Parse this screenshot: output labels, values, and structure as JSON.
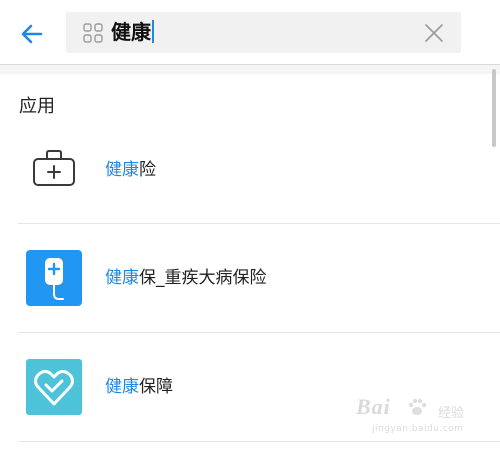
{
  "search": {
    "query": "健康"
  },
  "section": {
    "title": "应用"
  },
  "results": [
    {
      "highlight": "健康",
      "rest": "险",
      "icon": "medical-kit-icon"
    },
    {
      "highlight": "健康",
      "rest": "保_重疾大病保险",
      "icon": "iv-drip-icon"
    },
    {
      "highlight": "健康",
      "rest": "保障",
      "icon": "heart-check-icon"
    }
  ],
  "colors": {
    "accent": "#1e88e5",
    "search_bg": "#f1f1f1",
    "iv_icon_bg": "#2196f3",
    "heart_icon_bg": "#4cc3d9"
  },
  "watermark": {
    "brand": "Bai",
    "suffix": "经验",
    "url": "jingyan.baidu.com"
  }
}
